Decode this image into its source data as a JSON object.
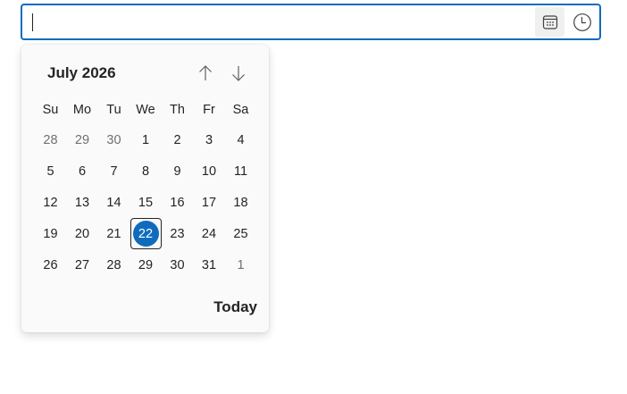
{
  "input": {
    "value": "",
    "placeholder": ""
  },
  "buttons": {
    "calendar_icon": "calendar-icon",
    "clock_icon": "clock-icon"
  },
  "calendar": {
    "month_label": "July 2026",
    "nav_up_icon": "arrow-up-icon",
    "nav_down_icon": "arrow-down-icon",
    "weekdays": [
      "Su",
      "Mo",
      "Tu",
      "We",
      "Th",
      "Fr",
      "Sa"
    ],
    "weeks": [
      [
        "28",
        "29",
        "30",
        "1",
        "2",
        "3",
        "4"
      ],
      [
        "5",
        "6",
        "7",
        "8",
        "9",
        "10",
        "11"
      ],
      [
        "12",
        "13",
        "14",
        "15",
        "16",
        "17",
        "18"
      ],
      [
        "19",
        "20",
        "21",
        "22",
        "23",
        "24",
        "25"
      ],
      [
        "26",
        "27",
        "28",
        "29",
        "30",
        "31",
        "1"
      ]
    ],
    "selected_day": "22",
    "today_label": "Today"
  },
  "colors": {
    "accent": "#0f6cbd",
    "text": "#242424",
    "muted_text": "#707070"
  }
}
